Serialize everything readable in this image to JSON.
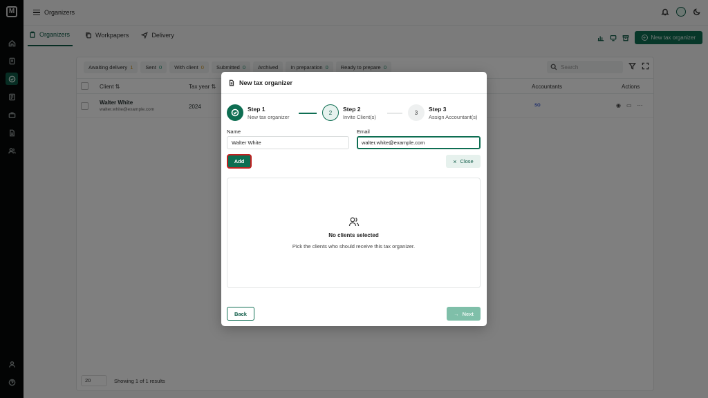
{
  "topbar": {
    "title": "Organizers"
  },
  "tabs": [
    {
      "label": "Organizers"
    },
    {
      "label": "Workpapers"
    },
    {
      "label": "Delivery"
    }
  ],
  "new_button_label": "New tax organizer",
  "filters": [
    {
      "label": "Awaiting delivery",
      "count": "1"
    },
    {
      "label": "Sent",
      "count": "0"
    },
    {
      "label": "With client",
      "count": "0"
    },
    {
      "label": "Submitted",
      "count": "0"
    },
    {
      "label": "Archived",
      "count": ""
    },
    {
      "label": "In preparation",
      "count": "0"
    },
    {
      "label": "Ready to prepare",
      "count": "0"
    }
  ],
  "search": {
    "placeholder": "Search"
  },
  "table": {
    "headers": {
      "client": "Client ⇅",
      "tax_year": "Tax year ⇅",
      "accountants": "Accountants",
      "actions": "Actions"
    },
    "row": {
      "name": "Walter White",
      "email": "walter.white@example.com",
      "year": "2024",
      "accountant_badge": "SO"
    }
  },
  "pager": {
    "per_page": "20",
    "summary": "Showing 1 of 1 results"
  },
  "modal": {
    "title": "New tax organizer",
    "steps": [
      {
        "name": "Step 1",
        "sub": "New tax organizer",
        "state": "done",
        "marker": ""
      },
      {
        "name": "Step 2",
        "sub": "Invite Client(s)",
        "state": "current",
        "marker": "2"
      },
      {
        "name": "Step 3",
        "sub": "Assign Accountant(s)",
        "state": "todo",
        "marker": "3"
      }
    ],
    "name_label": "Name",
    "name_value": "Walter White",
    "email_label": "Email",
    "email_value": "walter.white@example.com",
    "add_label": "Add",
    "close_label": "Close",
    "empty_title": "No clients selected",
    "empty_sub": "Pick the clients who should receive this tax organizer.",
    "back_label": "Back",
    "next_label": "Next"
  },
  "colors": {
    "primary": "#0e6e52",
    "highlight": "#c32020",
    "sidebar": "#070909"
  }
}
